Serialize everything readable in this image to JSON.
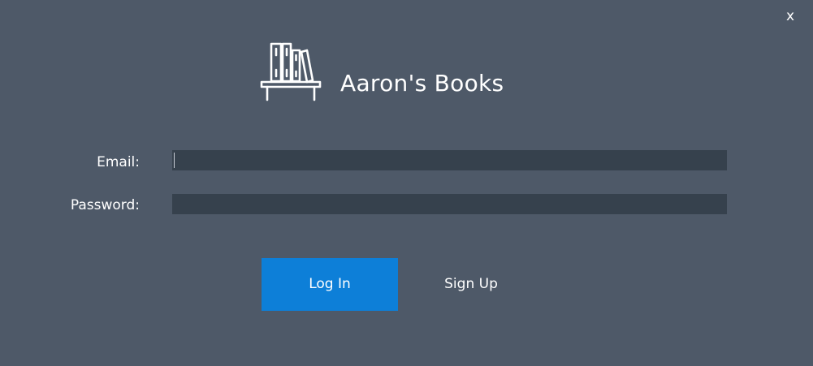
{
  "window": {
    "close_label": "x"
  },
  "app": {
    "title": "Aaron's Books",
    "logo_icon": "bookshelf-icon"
  },
  "form": {
    "email_label": "Email:",
    "email_value": "",
    "password_label": "Password:",
    "password_value": ""
  },
  "actions": {
    "login_label": "Log In",
    "signup_label": "Sign Up"
  },
  "colors": {
    "background": "#4e5968",
    "input_background": "#36414d",
    "accent": "#0d7fd8",
    "text": "#ffffff"
  }
}
